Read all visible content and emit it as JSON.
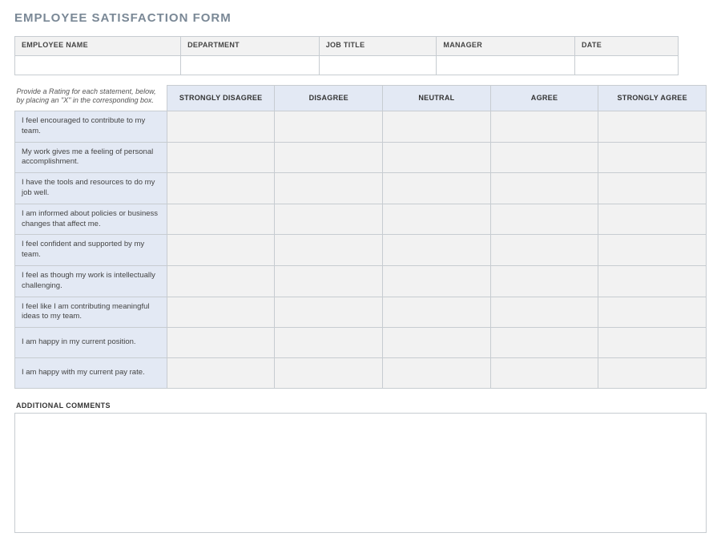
{
  "title": "EMPLOYEE SATISFACTION FORM",
  "info": {
    "headers": [
      "EMPLOYEE NAME",
      "DEPARTMENT",
      "JOB TITLE",
      "MANAGER",
      "DATE"
    ],
    "values": [
      "",
      "",
      "",
      "",
      ""
    ]
  },
  "rating": {
    "instructions": "Provide a Rating for each statement, below, by placing an \"X\" in the corresponding box.",
    "columns": [
      "STRONGLY DISAGREE",
      "DISAGREE",
      "NEUTRAL",
      "AGREE",
      "STRONGLY AGREE"
    ],
    "statements": [
      "I feel encouraged to contribute to my team.",
      "My work gives me a feeling of personal accomplishment.",
      "I have the tools and resources to do my job well.",
      "I am informed about policies or business changes that affect me.",
      "I feel confident and supported by my team.",
      "I feel as though my work is intellectually challenging.",
      "I feel like I am contributing meaningful ideas to my team.",
      "I am happy in my current position.",
      "I am happy with my current pay rate."
    ]
  },
  "comments": {
    "label": "ADDITIONAL COMMENTS",
    "value": ""
  }
}
